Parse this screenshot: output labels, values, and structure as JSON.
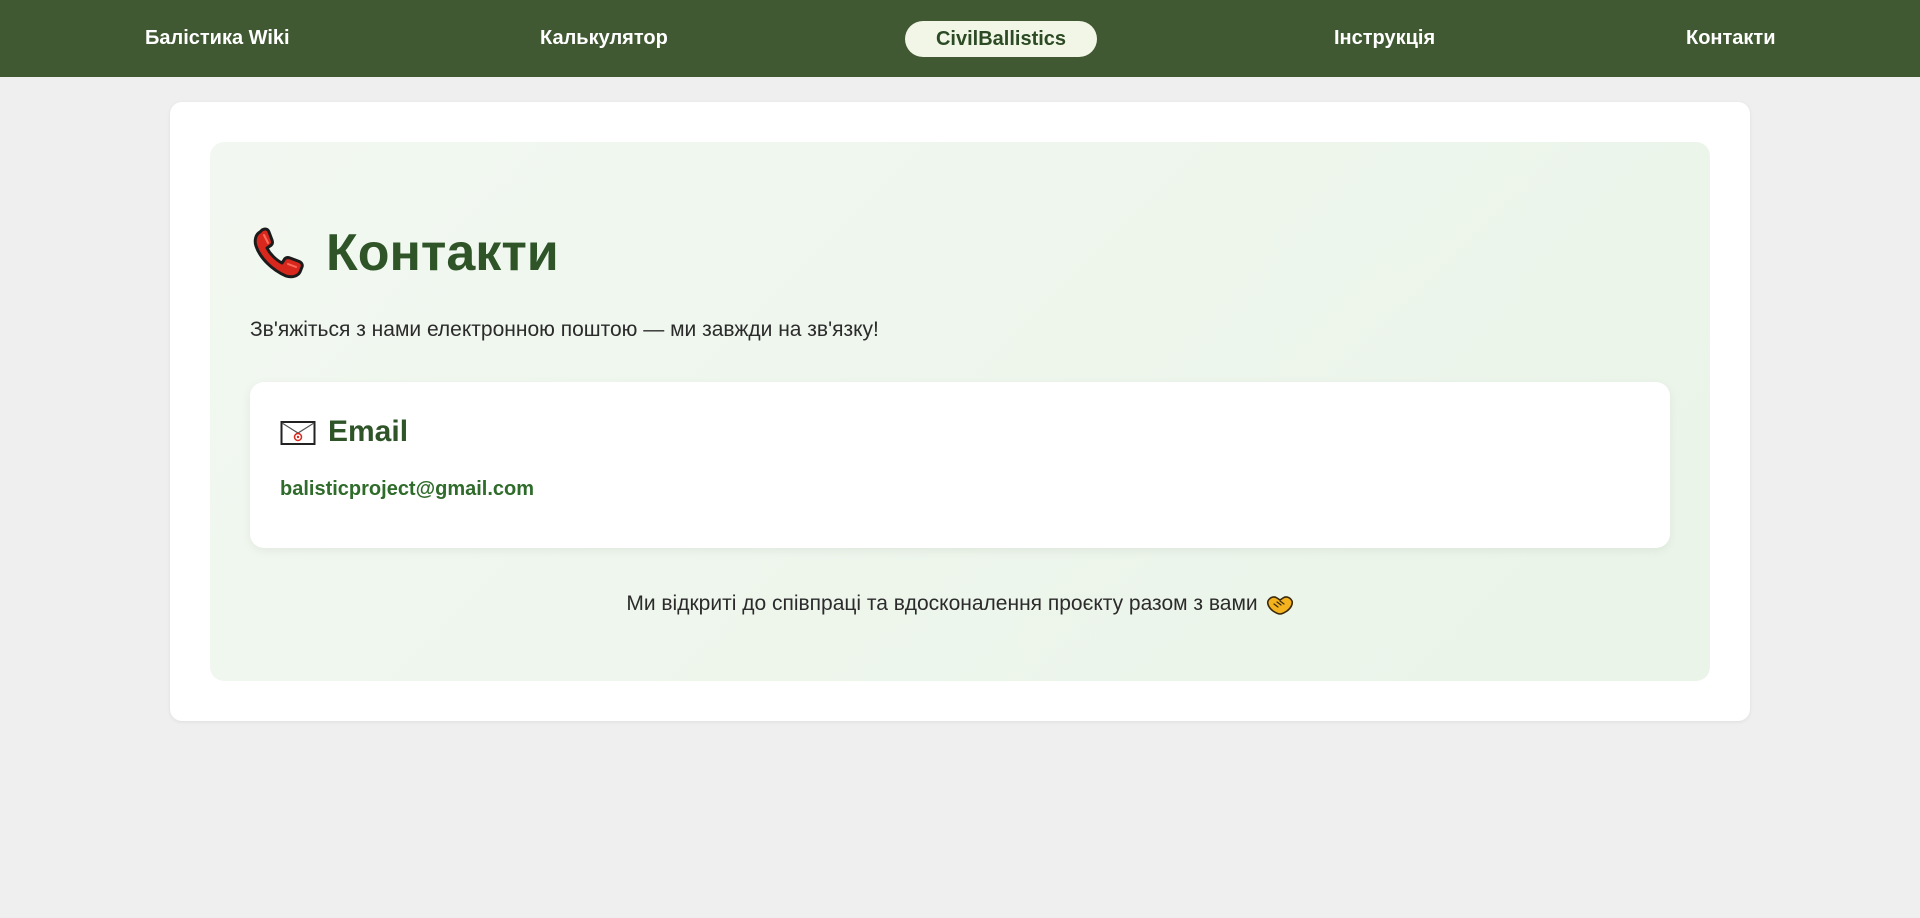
{
  "nav": {
    "items": [
      {
        "label": "Балістика Wiki"
      },
      {
        "label": "Калькулятор"
      },
      {
        "label": "Інструкція"
      },
      {
        "label": "Контакти"
      }
    ],
    "brand": "CivilBallistics"
  },
  "page": {
    "title": "Контакти",
    "title_icon": "phone-icon",
    "intro": "Зв'яжіться з нами електронною поштою — ми завжди на зв'язку!",
    "email_card": {
      "heading": "Email",
      "heading_icon": "envelope-icon",
      "address": "balisticproject@gmail.com"
    },
    "footer_note": "Ми відкриті до співпраці та вдосконалення проєкту разом з вами",
    "footer_icon": "handshake-icon"
  },
  "colors": {
    "nav_background": "#415932",
    "accent_green": "#2e5428",
    "link_green": "#2f6b2a",
    "panel_background": "#eef6ec"
  }
}
